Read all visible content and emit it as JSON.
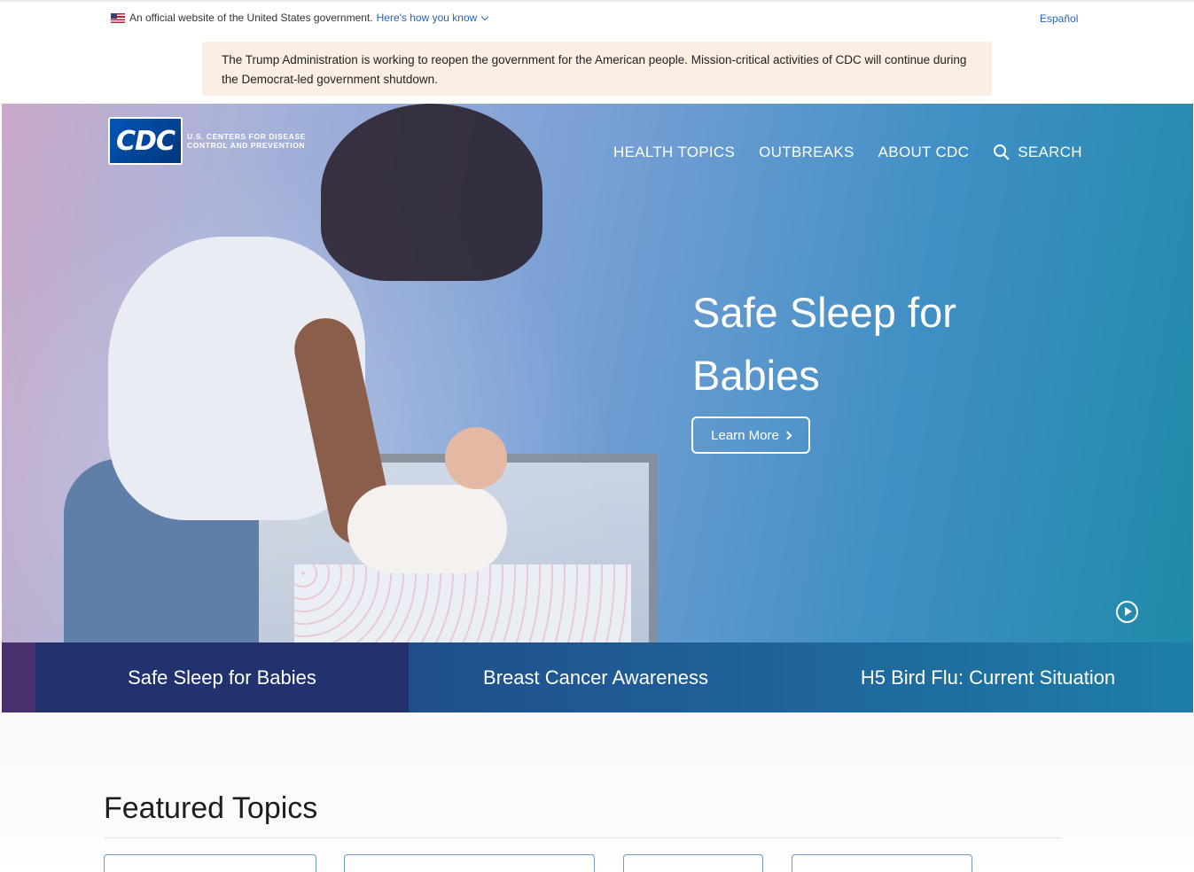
{
  "gov_banner": {
    "official_text": "An official website of the United States government.",
    "how_you_know": "Here's how you know",
    "language_link": "Español"
  },
  "notice": {
    "text": "The Trump Administration is working to reopen the government for the American people. Mission-critical activities of CDC will continue during the Democrat-led government shutdown."
  },
  "header": {
    "logo_mark": "CDC",
    "logo_text": "U.S. CENTERS FOR DISEASE CONTROL AND PREVENTION",
    "nav": [
      "HEALTH TOPICS",
      "OUTBREAKS",
      "ABOUT CDC"
    ],
    "search_label": "SEARCH"
  },
  "hero": {
    "title": "Safe Sleep for Babies",
    "cta": "Learn More",
    "play_icon": "play-circle-icon"
  },
  "carousel_tabs": [
    "Safe Sleep for Babies",
    "Breast Cancer Awareness",
    "H5 Bird Flu: Current Situation"
  ],
  "featured": {
    "heading": "Featured Topics"
  },
  "colors": {
    "link_blue": "#2763c0",
    "notice_bg": "#fbeee3",
    "tab_active": "#22326f",
    "tab_accent": "#4a2f6e"
  }
}
